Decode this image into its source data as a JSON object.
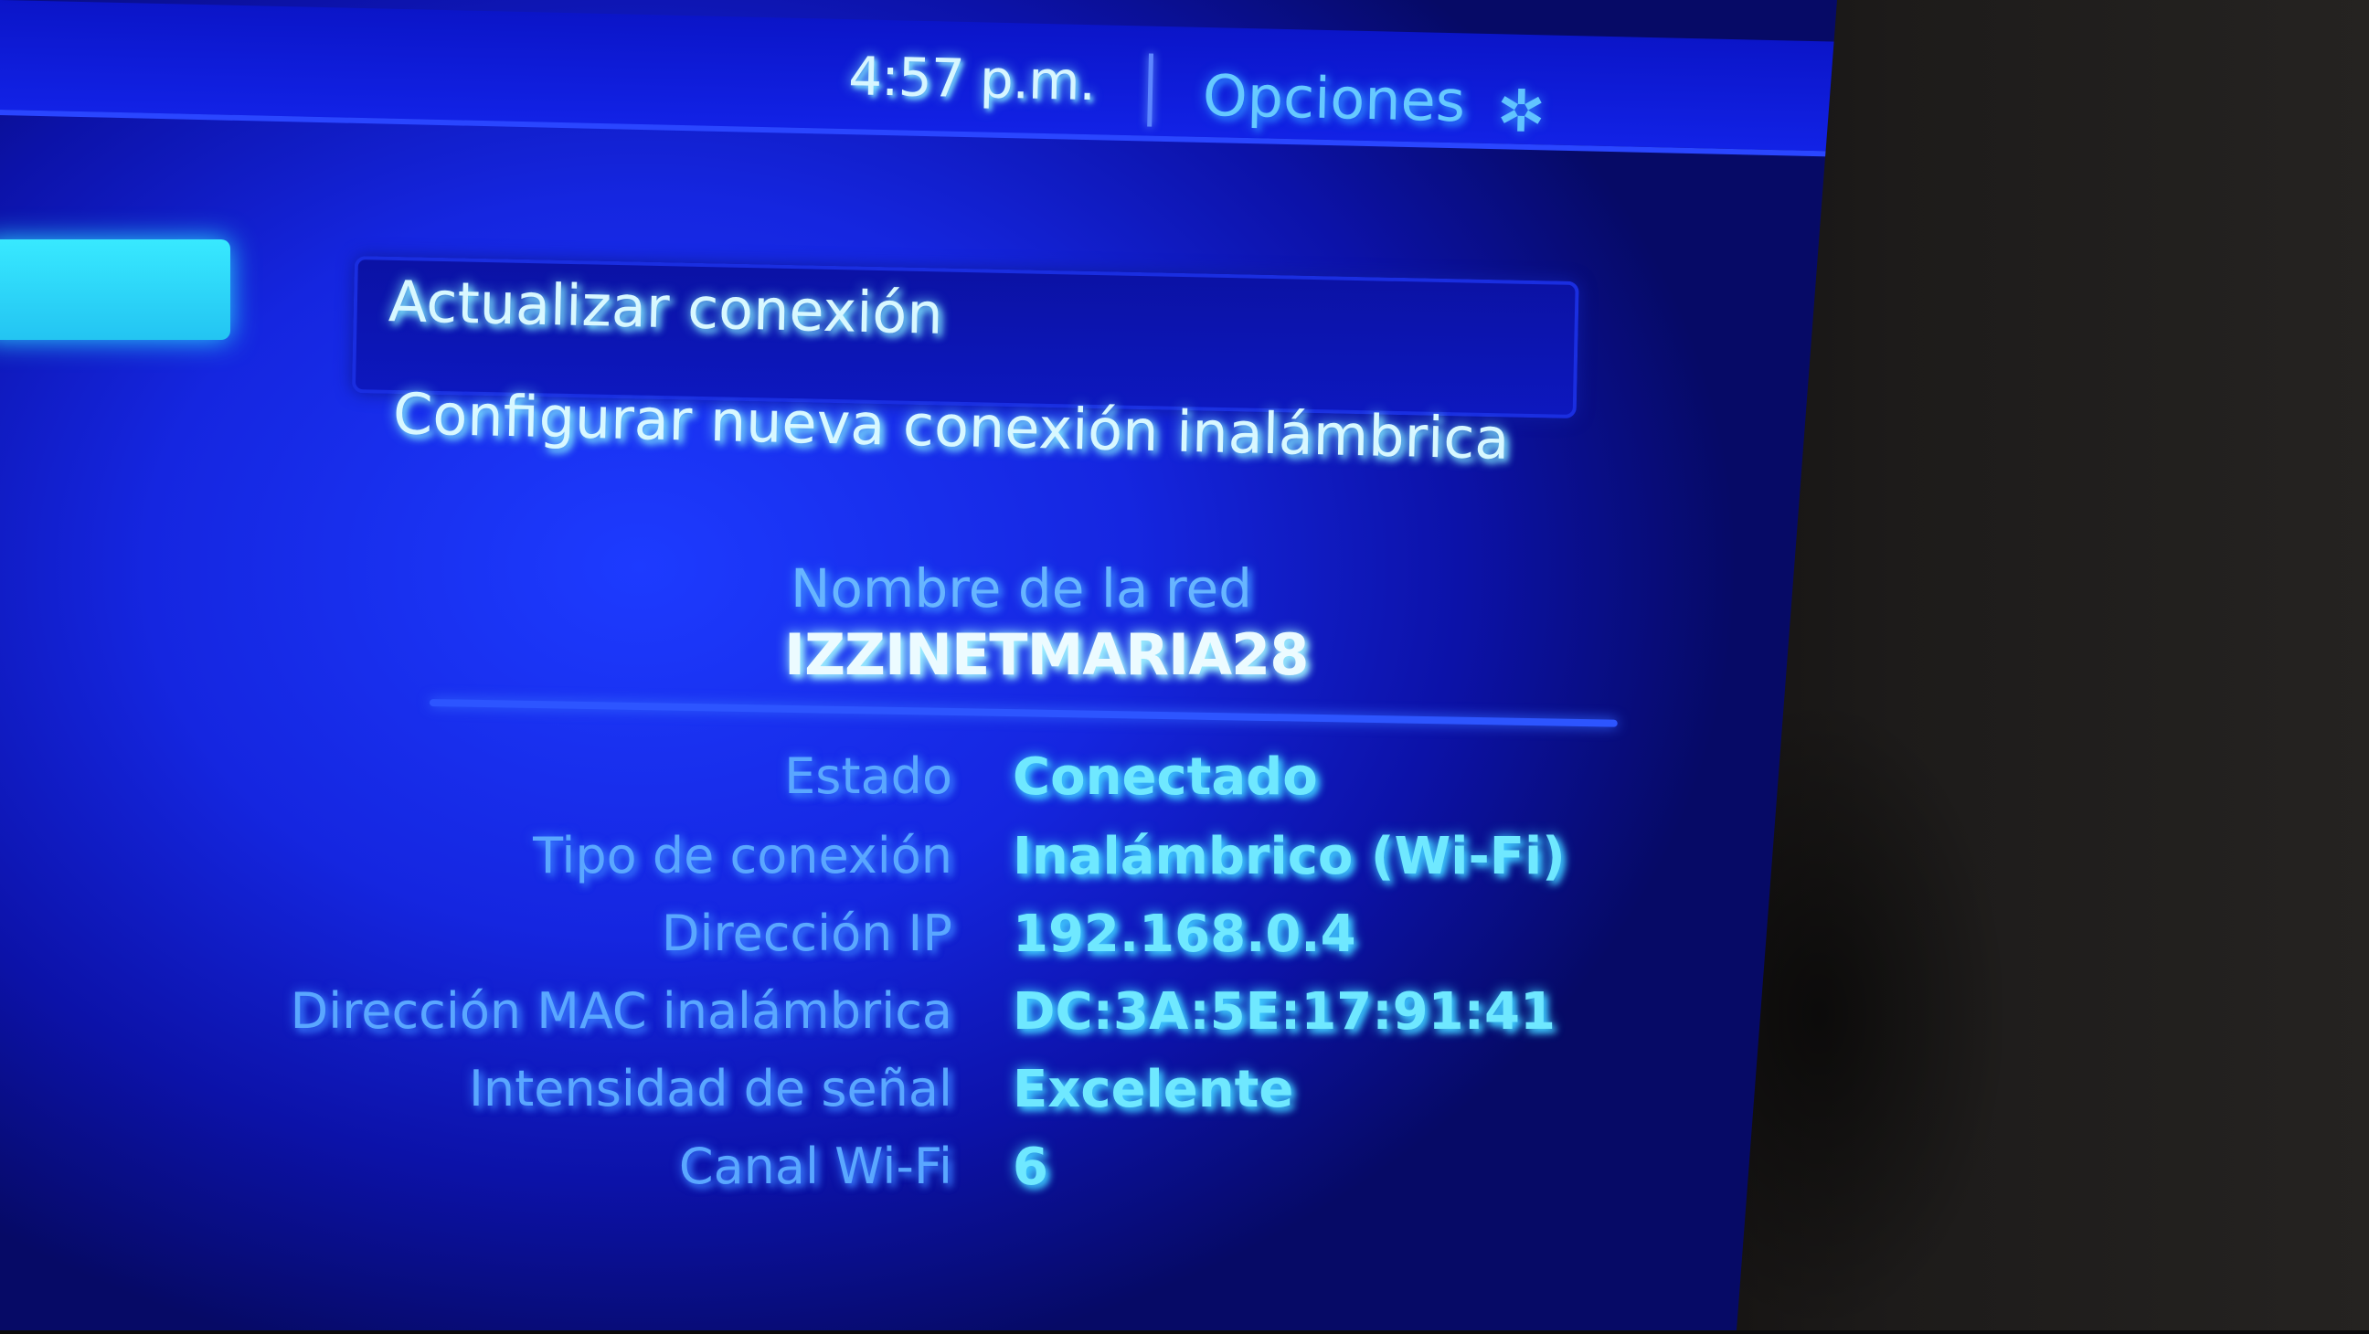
{
  "header": {
    "time": "4:57 p.m.",
    "options_label": "Opciones",
    "options_icon": "asterisk-icon"
  },
  "menu": {
    "items": [
      {
        "label": "Actualizar conexión"
      },
      {
        "label": "Configurar nueva conexión inalámbrica"
      }
    ],
    "selected_index": 0
  },
  "network": {
    "name_label": "Nombre de la red",
    "name_value": "IZZINETMARIA28"
  },
  "info": [
    {
      "label": "Estado",
      "value": "Conectado"
    },
    {
      "label": "Tipo de conexión",
      "value": "Inalámbrico (Wi-Fi)"
    },
    {
      "label": "Dirección IP",
      "value": "192.168.0.4"
    },
    {
      "label": "Dirección MAC inalámbrica",
      "value": "DC:3A:5E:17:91:41"
    },
    {
      "label": "Intensidad de señal",
      "value": "Excelente"
    },
    {
      "label": "Canal Wi-Fi",
      "value": "6"
    }
  ],
  "colors": {
    "background": "#1526e0",
    "text_primary": "#d8f8ff",
    "text_label": "#5aa7ff",
    "text_value": "#6fe8ff",
    "highlight_tile": "#38e9ff"
  }
}
